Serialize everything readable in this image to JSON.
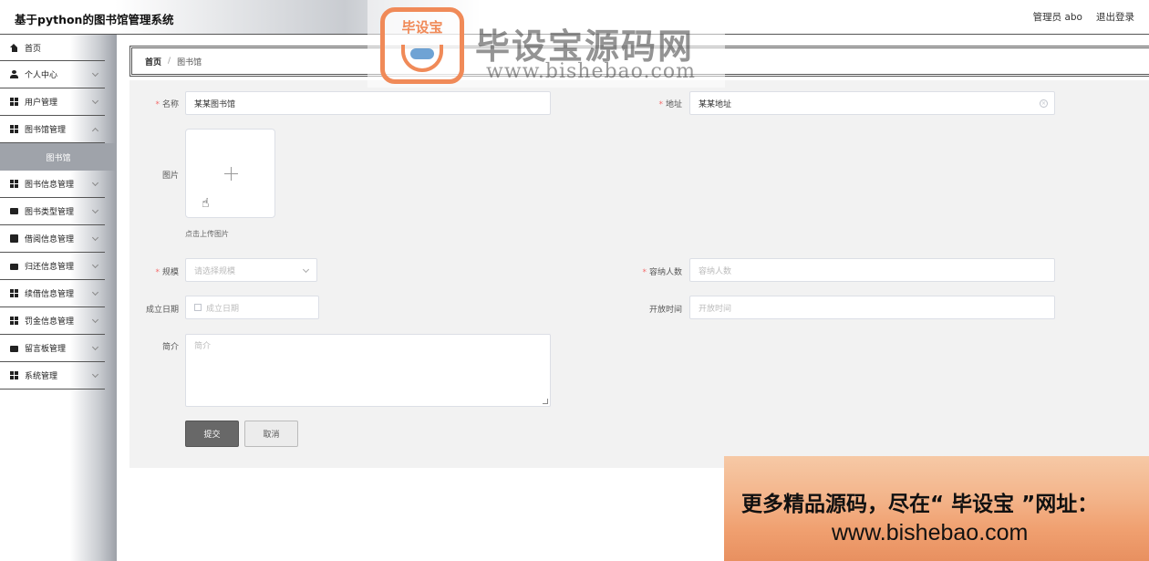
{
  "header": {
    "title": "基于python的图书馆管理系统",
    "admin": "管理员 abo",
    "logout": "退出登录"
  },
  "sidebar": {
    "items": [
      {
        "label": "首页",
        "icon": "home-icon"
      },
      {
        "label": "个人中心",
        "icon": "user-icon"
      },
      {
        "label": "用户管理",
        "icon": "grid-icon"
      },
      {
        "label": "图书馆管理",
        "icon": "grid-icon"
      },
      {
        "label": "图书馆",
        "icon": ""
      },
      {
        "label": "图书信息管理",
        "icon": "grid-icon"
      },
      {
        "label": "图书类型管理",
        "icon": "chat-icon"
      },
      {
        "label": "借阅信息管理",
        "icon": "chart-icon"
      },
      {
        "label": "归还信息管理",
        "icon": "return-icon"
      },
      {
        "label": "续借信息管理",
        "icon": "grid-icon"
      },
      {
        "label": "罚金信息管理",
        "icon": "grid-icon"
      },
      {
        "label": "留言板管理",
        "icon": "briefcase-icon"
      },
      {
        "label": "系统管理",
        "icon": "grid-icon"
      }
    ]
  },
  "breadcrumb": {
    "home": "首页",
    "separator": "/",
    "current": "图书馆"
  },
  "form": {
    "name": {
      "label": "名称",
      "value": "某某图书馆"
    },
    "address": {
      "label": "地址",
      "value": "某某地址"
    },
    "image": {
      "label": "图片",
      "hint": "点击上传图片"
    },
    "scale": {
      "label": "规模",
      "placeholder": "请选择规模"
    },
    "capacity": {
      "label": "容纳人数",
      "placeholder": "容纳人数"
    },
    "founded": {
      "label": "成立日期",
      "placeholder": "成立日期"
    },
    "hours": {
      "label": "开放时间",
      "placeholder": "开放时间"
    },
    "intro": {
      "label": "简介",
      "placeholder": "简介"
    },
    "submit": "提交",
    "cancel": "取消"
  },
  "watermark": {
    "brand": "毕设宝",
    "title": "毕设宝源码网",
    "url": "www.bishebao.com"
  },
  "promo": {
    "line1": "更多精品源码，尽在“ 毕设宝 ”网址：",
    "line2": "www.bishebao.com"
  },
  "colors": {
    "required": "#f56c6c",
    "submit_bg": "#686868",
    "accent": "#f08a58"
  }
}
